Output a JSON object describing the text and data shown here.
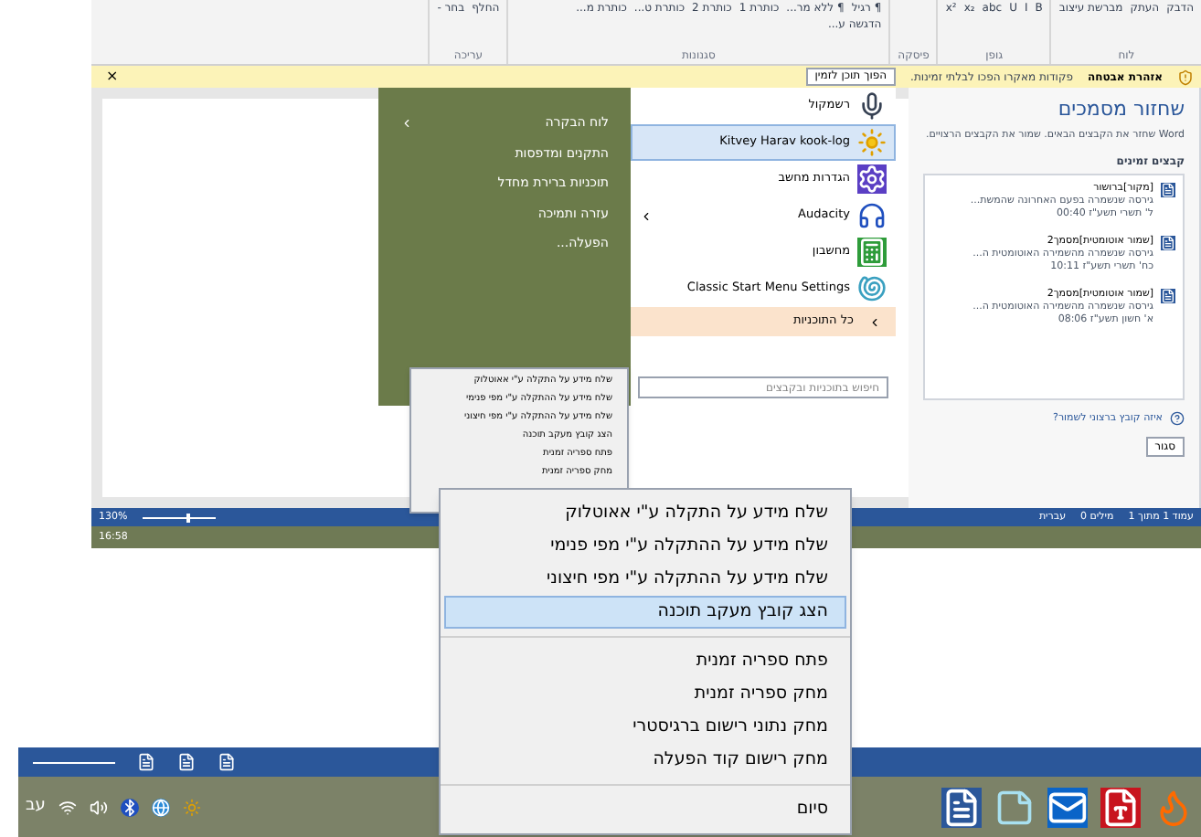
{
  "ribbon": {
    "groups": [
      {
        "name": "לוח",
        "items": [
          "הדבק",
          "העתק",
          "מברשת עיצוב"
        ]
      },
      {
        "name": "גופן",
        "items": [
          "B",
          "I",
          "U",
          "abc",
          "x₂",
          "x²"
        ]
      },
      {
        "name": "פיסקה"
      },
      {
        "name": "סגנונות",
        "items": [
          "¶ רגיל",
          "¶ ללא מר...",
          "כותרת 1",
          "כותרת 2",
          "כותרת ט...",
          "כותרת מ...",
          "הדגשה ע..."
        ]
      },
      {
        "name": "עריכה",
        "items": [
          "החלף",
          "בחר -"
        ]
      }
    ]
  },
  "security_bar": {
    "title": "אזהרת אבטחה",
    "message": "פקודות מאקרו הפכו לבלתי זמינות.",
    "button": "הפוך תוכן לזמין",
    "close": "×"
  },
  "start_menu": {
    "links": [
      {
        "label": "לוח הבקרה",
        "submenu": true
      },
      {
        "label": "התקנים ומדפסות",
        "submenu": false
      },
      {
        "label": "תוכניות ברירת מחדל",
        "submenu": false
      },
      {
        "label": "עזרה ותמיכה",
        "submenu": false
      },
      {
        "label": "הפעלה...",
        "submenu": false
      }
    ],
    "programs": [
      {
        "label": "רשמקול",
        "kind": "mic",
        "selected": false,
        "submenu": false
      },
      {
        "label": "Kitvey Harav kook-log",
        "kind": "sun",
        "selected": true,
        "submenu": false
      },
      {
        "label": "הגדרות מחשב",
        "kind": "gear",
        "selected": false,
        "submenu": false
      },
      {
        "label": "Audacity",
        "kind": "headphones",
        "selected": false,
        "submenu": true
      },
      {
        "label": "מחשבון",
        "kind": "calculator",
        "selected": false,
        "submenu": false
      },
      {
        "label": "Classic Start Menu Settings",
        "kind": "shell",
        "selected": false,
        "submenu": false
      }
    ],
    "all_programs": "כל התוכניות",
    "search_placeholder": "חיפוש בתוכניות ובקבצים"
  },
  "recovery_pane": {
    "title": "שחזור מסמכים",
    "description": "Word שחזר את הקבצים הבאים. שמור את הקבצים הרצויים.",
    "list_title": "קבצים זמינים",
    "files": [
      {
        "name": "[מקור]ברושור",
        "version": "גירסה שנשמרה בפעם האחרונה שהמשת...",
        "date": "ל' תשרי תשע\"ז 00:40"
      },
      {
        "name": "[שמור אוטומטית]מסמך2",
        "version": "גירסה שנשמרה מהשמירה האוטומטית ה...",
        "date": "כח' תשרי תשע\"ז 10:11"
      },
      {
        "name": "[שמור אוטומטית]מסמך2",
        "version": "גירסה שנשמרה מהשמירה האוטומטית ה...",
        "date": "א' חשון תשע\"ז 08:06"
      }
    ],
    "help_link": "איזה קובץ ברצוני לשמור?",
    "close_button": "סגור"
  },
  "status_bar": {
    "zoom": "130%",
    "level": 0.6,
    "page": "עמוד 1 מתוך 1",
    "words": "0 מילים",
    "language": "עברית"
  },
  "taskbar": {
    "time": "16:58",
    "language": "עב"
  },
  "small_context_menu": {
    "items": [
      {
        "label": "שלח מידע על התקלה ע\"י אאוטלוק",
        "selected": false
      },
      {
        "label": "שלח מידע על ההתקלה ע\"י מפי פנימי",
        "selected": false
      },
      {
        "label": "שלח מידע על ההתקלה ע\"י מפי חיצוני",
        "selected": false
      },
      {
        "label": "הצג קובץ מעקב תוכנה",
        "selected": false
      },
      {
        "label": "פתח ספריה זמנית",
        "selected": false
      },
      {
        "label": "מחק ספריה זמנית",
        "selected": false
      }
    ]
  },
  "context_menu": {
    "groups": [
      [
        {
          "label": "שלח מידע על התקלה ע\"י אאוטלוק",
          "selected": false
        },
        {
          "label": "שלח מידע על ההתקלה ע\"י מפי פנימי",
          "selected": false
        },
        {
          "label": "שלח מידע על ההתקלה ע\"י מפי חיצוני",
          "selected": false
        },
        {
          "label": "הצג קובץ מעקב תוכנה",
          "selected": true
        }
      ],
      [
        {
          "label": "פתח ספריה זמנית",
          "selected": false
        },
        {
          "label": "מחק ספריה זמנית",
          "selected": false
        },
        {
          "label": "מחק נתוני רישום ברגיסטרי",
          "selected": false
        },
        {
          "label": "מחק רישום קוד הפעלה",
          "selected": false
        }
      ],
      [
        {
          "label": "סיום",
          "selected": false
        }
      ]
    ]
  }
}
